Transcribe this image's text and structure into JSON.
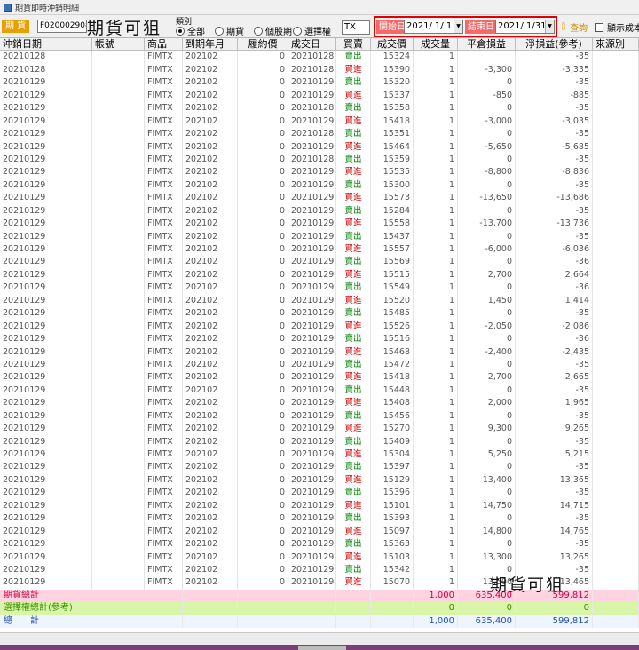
{
  "window": {
    "title": "期貨即時沖銷明細"
  },
  "toolbar": {
    "acct_label": "期 貨",
    "acct_value": "F020002908",
    "watermark": "期貨可狙",
    "category_label": "類別",
    "radios": [
      {
        "label": "全部",
        "checked": true
      },
      {
        "label": "期貨",
        "checked": false
      },
      {
        "label": "個股期",
        "checked": false
      },
      {
        "label": "選擇權",
        "checked": false
      }
    ],
    "product_value": "TX",
    "start_label": "開始日",
    "start_value": "2021/ 1/ 1",
    "end_label": "結束日",
    "end_value": "2021/ 1/31",
    "query_label": "查詢",
    "cost_checkbox_label": "顯示成本"
  },
  "table": {
    "headers": [
      "沖銷日期",
      "帳號",
      "商品",
      "到期年月",
      "履約價",
      "成交日",
      "買賣",
      "成交價",
      "成交量",
      "平倉損益",
      "淨損益(參考)",
      "來源別"
    ],
    "rows": [
      [
        "20210128",
        "",
        "FIMTX",
        "202102",
        "0",
        "20210128",
        "賣出",
        "15324",
        "1",
        "",
        "-35",
        ""
      ],
      [
        "20210128",
        "",
        "FIMTX",
        "202102",
        "0",
        "20210128",
        "買進",
        "15390",
        "1",
        "-3,300",
        "-3,335",
        ""
      ],
      [
        "20210129",
        "",
        "FIMTX",
        "202102",
        "0",
        "20210129",
        "賣出",
        "15320",
        "1",
        "0",
        "-35",
        ""
      ],
      [
        "20210129",
        "",
        "FIMTX",
        "202102",
        "0",
        "20210129",
        "買進",
        "15337",
        "1",
        "-850",
        "-885",
        ""
      ],
      [
        "20210129",
        "",
        "FIMTX",
        "202102",
        "0",
        "20210128",
        "賣出",
        "15358",
        "1",
        "0",
        "-35",
        ""
      ],
      [
        "20210129",
        "",
        "FIMTX",
        "202102",
        "0",
        "20210129",
        "買進",
        "15418",
        "1",
        "-3,000",
        "-3,035",
        ""
      ],
      [
        "20210129",
        "",
        "FIMTX",
        "202102",
        "0",
        "20210128",
        "賣出",
        "15351",
        "1",
        "0",
        "-35",
        ""
      ],
      [
        "20210129",
        "",
        "FIMTX",
        "202102",
        "0",
        "20210129",
        "買進",
        "15464",
        "1",
        "-5,650",
        "-5,685",
        ""
      ],
      [
        "20210129",
        "",
        "FIMTX",
        "202102",
        "0",
        "20210128",
        "賣出",
        "15359",
        "1",
        "0",
        "-35",
        ""
      ],
      [
        "20210129",
        "",
        "FIMTX",
        "202102",
        "0",
        "20210129",
        "買進",
        "15535",
        "1",
        "-8,800",
        "-8,836",
        ""
      ],
      [
        "20210129",
        "",
        "FIMTX",
        "202102",
        "0",
        "20210129",
        "賣出",
        "15300",
        "1",
        "0",
        "-35",
        ""
      ],
      [
        "20210129",
        "",
        "FIMTX",
        "202102",
        "0",
        "20210129",
        "買進",
        "15573",
        "1",
        "-13,650",
        "-13,686",
        ""
      ],
      [
        "20210129",
        "",
        "FIMTX",
        "202102",
        "0",
        "20210129",
        "賣出",
        "15284",
        "1",
        "0",
        "-35",
        ""
      ],
      [
        "20210129",
        "",
        "FIMTX",
        "202102",
        "0",
        "20210129",
        "買進",
        "15558",
        "1",
        "-13,700",
        "-13,736",
        ""
      ],
      [
        "20210129",
        "",
        "FIMTX",
        "202102",
        "0",
        "20210129",
        "賣出",
        "15437",
        "1",
        "0",
        "-35",
        ""
      ],
      [
        "20210129",
        "",
        "FIMTX",
        "202102",
        "0",
        "20210129",
        "買進",
        "15557",
        "1",
        "-6,000",
        "-6,036",
        ""
      ],
      [
        "20210129",
        "",
        "FIMTX",
        "202102",
        "0",
        "20210129",
        "賣出",
        "15569",
        "1",
        "0",
        "-36",
        ""
      ],
      [
        "20210129",
        "",
        "FIMTX",
        "202102",
        "0",
        "20210129",
        "買進",
        "15515",
        "1",
        "2,700",
        "2,664",
        ""
      ],
      [
        "20210129",
        "",
        "FIMTX",
        "202102",
        "0",
        "20210129",
        "賣出",
        "15549",
        "1",
        "0",
        "-36",
        ""
      ],
      [
        "20210129",
        "",
        "FIMTX",
        "202102",
        "0",
        "20210129",
        "買進",
        "15520",
        "1",
        "1,450",
        "1,414",
        ""
      ],
      [
        "20210129",
        "",
        "FIMTX",
        "202102",
        "0",
        "20210129",
        "賣出",
        "15485",
        "1",
        "0",
        "-35",
        ""
      ],
      [
        "20210129",
        "",
        "FIMTX",
        "202102",
        "0",
        "20210129",
        "買進",
        "15526",
        "1",
        "-2,050",
        "-2,086",
        ""
      ],
      [
        "20210129",
        "",
        "FIMTX",
        "202102",
        "0",
        "20210129",
        "賣出",
        "15516",
        "1",
        "0",
        "-36",
        ""
      ],
      [
        "20210129",
        "",
        "FIMTX",
        "202102",
        "0",
        "20210129",
        "買進",
        "15468",
        "1",
        "-2,400",
        "-2,435",
        ""
      ],
      [
        "20210129",
        "",
        "FIMTX",
        "202102",
        "0",
        "20210129",
        "賣出",
        "15472",
        "1",
        "0",
        "-35",
        ""
      ],
      [
        "20210129",
        "",
        "FIMTX",
        "202102",
        "0",
        "20210129",
        "買進",
        "15418",
        "1",
        "2,700",
        "2,665",
        ""
      ],
      [
        "20210129",
        "",
        "FIMTX",
        "202102",
        "0",
        "20210129",
        "賣出",
        "15448",
        "1",
        "0",
        "-35",
        ""
      ],
      [
        "20210129",
        "",
        "FIMTX",
        "202102",
        "0",
        "20210129",
        "買進",
        "15408",
        "1",
        "2,000",
        "1,965",
        ""
      ],
      [
        "20210129",
        "",
        "FIMTX",
        "202102",
        "0",
        "20210129",
        "賣出",
        "15456",
        "1",
        "0",
        "-35",
        ""
      ],
      [
        "20210129",
        "",
        "FIMTX",
        "202102",
        "0",
        "20210129",
        "買進",
        "15270",
        "1",
        "9,300",
        "9,265",
        ""
      ],
      [
        "20210129",
        "",
        "FIMTX",
        "202102",
        "0",
        "20210129",
        "賣出",
        "15409",
        "1",
        "0",
        "-35",
        ""
      ],
      [
        "20210129",
        "",
        "FIMTX",
        "202102",
        "0",
        "20210129",
        "買進",
        "15304",
        "1",
        "5,250",
        "5,215",
        ""
      ],
      [
        "20210129",
        "",
        "FIMTX",
        "202102",
        "0",
        "20210129",
        "賣出",
        "15397",
        "1",
        "0",
        "-35",
        ""
      ],
      [
        "20210129",
        "",
        "FIMTX",
        "202102",
        "0",
        "20210129",
        "買進",
        "15129",
        "1",
        "13,400",
        "13,365",
        ""
      ],
      [
        "20210129",
        "",
        "FIMTX",
        "202102",
        "0",
        "20210129",
        "賣出",
        "15396",
        "1",
        "0",
        "-35",
        ""
      ],
      [
        "20210129",
        "",
        "FIMTX",
        "202102",
        "0",
        "20210129",
        "買進",
        "15101",
        "1",
        "14,750",
        "14,715",
        ""
      ],
      [
        "20210129",
        "",
        "FIMTX",
        "202102",
        "0",
        "20210129",
        "賣出",
        "15393",
        "1",
        "0",
        "-35",
        ""
      ],
      [
        "20210129",
        "",
        "FIMTX",
        "202102",
        "0",
        "20210129",
        "買進",
        "15097",
        "1",
        "14,800",
        "14,765",
        ""
      ],
      [
        "20210129",
        "",
        "FIMTX",
        "202102",
        "0",
        "20210129",
        "賣出",
        "15363",
        "1",
        "0",
        "-35",
        ""
      ],
      [
        "20210129",
        "",
        "FIMTX",
        "202102",
        "0",
        "20210129",
        "買進",
        "15103",
        "1",
        "13,300",
        "13,265",
        ""
      ],
      [
        "20210129",
        "",
        "FIMTX",
        "202102",
        "0",
        "20210129",
        "賣出",
        "15342",
        "1",
        "0",
        "-35",
        ""
      ],
      [
        "20210129",
        "",
        "FIMTX",
        "202102",
        "0",
        "20210129",
        "買進",
        "15070",
        "1",
        "13,500",
        "13,465",
        ""
      ]
    ],
    "summary": [
      {
        "label": "期貨總計",
        "qty": "1,000",
        "pl": "635,400",
        "net": "599,812"
      },
      {
        "label": "選擇權總計(參考)",
        "qty": "0",
        "pl": "0",
        "net": "0"
      },
      {
        "label": "總　　計",
        "qty": "1,000",
        "pl": "635,400",
        "net": "599,812"
      }
    ]
  },
  "colors": {
    "buy": "#d00000",
    "sell": "#008000",
    "accent": "#e8a000",
    "date_frame": "#e00000"
  }
}
